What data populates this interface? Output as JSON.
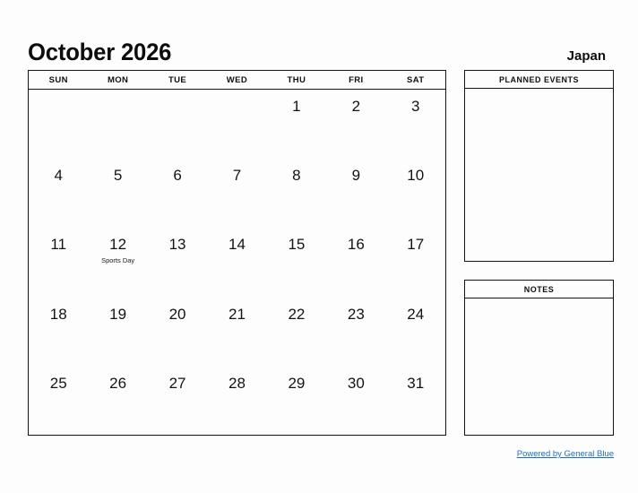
{
  "header": {
    "title": "October 2026",
    "region": "Japan"
  },
  "calendar": {
    "weekdays": [
      "SUN",
      "MON",
      "TUE",
      "WED",
      "THU",
      "FRI",
      "SAT"
    ],
    "weeks": [
      [
        {
          "day": "",
          "event": ""
        },
        {
          "day": "",
          "event": ""
        },
        {
          "day": "",
          "event": ""
        },
        {
          "day": "",
          "event": ""
        },
        {
          "day": "1",
          "event": ""
        },
        {
          "day": "2",
          "event": ""
        },
        {
          "day": "3",
          "event": ""
        }
      ],
      [
        {
          "day": "4",
          "event": ""
        },
        {
          "day": "5",
          "event": ""
        },
        {
          "day": "6",
          "event": ""
        },
        {
          "day": "7",
          "event": ""
        },
        {
          "day": "8",
          "event": ""
        },
        {
          "day": "9",
          "event": ""
        },
        {
          "day": "10",
          "event": ""
        }
      ],
      [
        {
          "day": "11",
          "event": ""
        },
        {
          "day": "12",
          "event": "Sports Day"
        },
        {
          "day": "13",
          "event": ""
        },
        {
          "day": "14",
          "event": ""
        },
        {
          "day": "15",
          "event": ""
        },
        {
          "day": "16",
          "event": ""
        },
        {
          "day": "17",
          "event": ""
        }
      ],
      [
        {
          "day": "18",
          "event": ""
        },
        {
          "day": "19",
          "event": ""
        },
        {
          "day": "20",
          "event": ""
        },
        {
          "day": "21",
          "event": ""
        },
        {
          "day": "22",
          "event": ""
        },
        {
          "day": "23",
          "event": ""
        },
        {
          "day": "24",
          "event": ""
        }
      ],
      [
        {
          "day": "25",
          "event": ""
        },
        {
          "day": "26",
          "event": ""
        },
        {
          "day": "27",
          "event": ""
        },
        {
          "day": "28",
          "event": ""
        },
        {
          "day": "29",
          "event": ""
        },
        {
          "day": "30",
          "event": ""
        },
        {
          "day": "31",
          "event": ""
        }
      ]
    ]
  },
  "panels": {
    "planned_events": {
      "title": "PLANNED EVENTS",
      "content": ""
    },
    "notes": {
      "title": "NOTES",
      "content": ""
    }
  },
  "footer": {
    "link_text": "Powered by General Blue",
    "link_color": "#1a6fd4"
  }
}
